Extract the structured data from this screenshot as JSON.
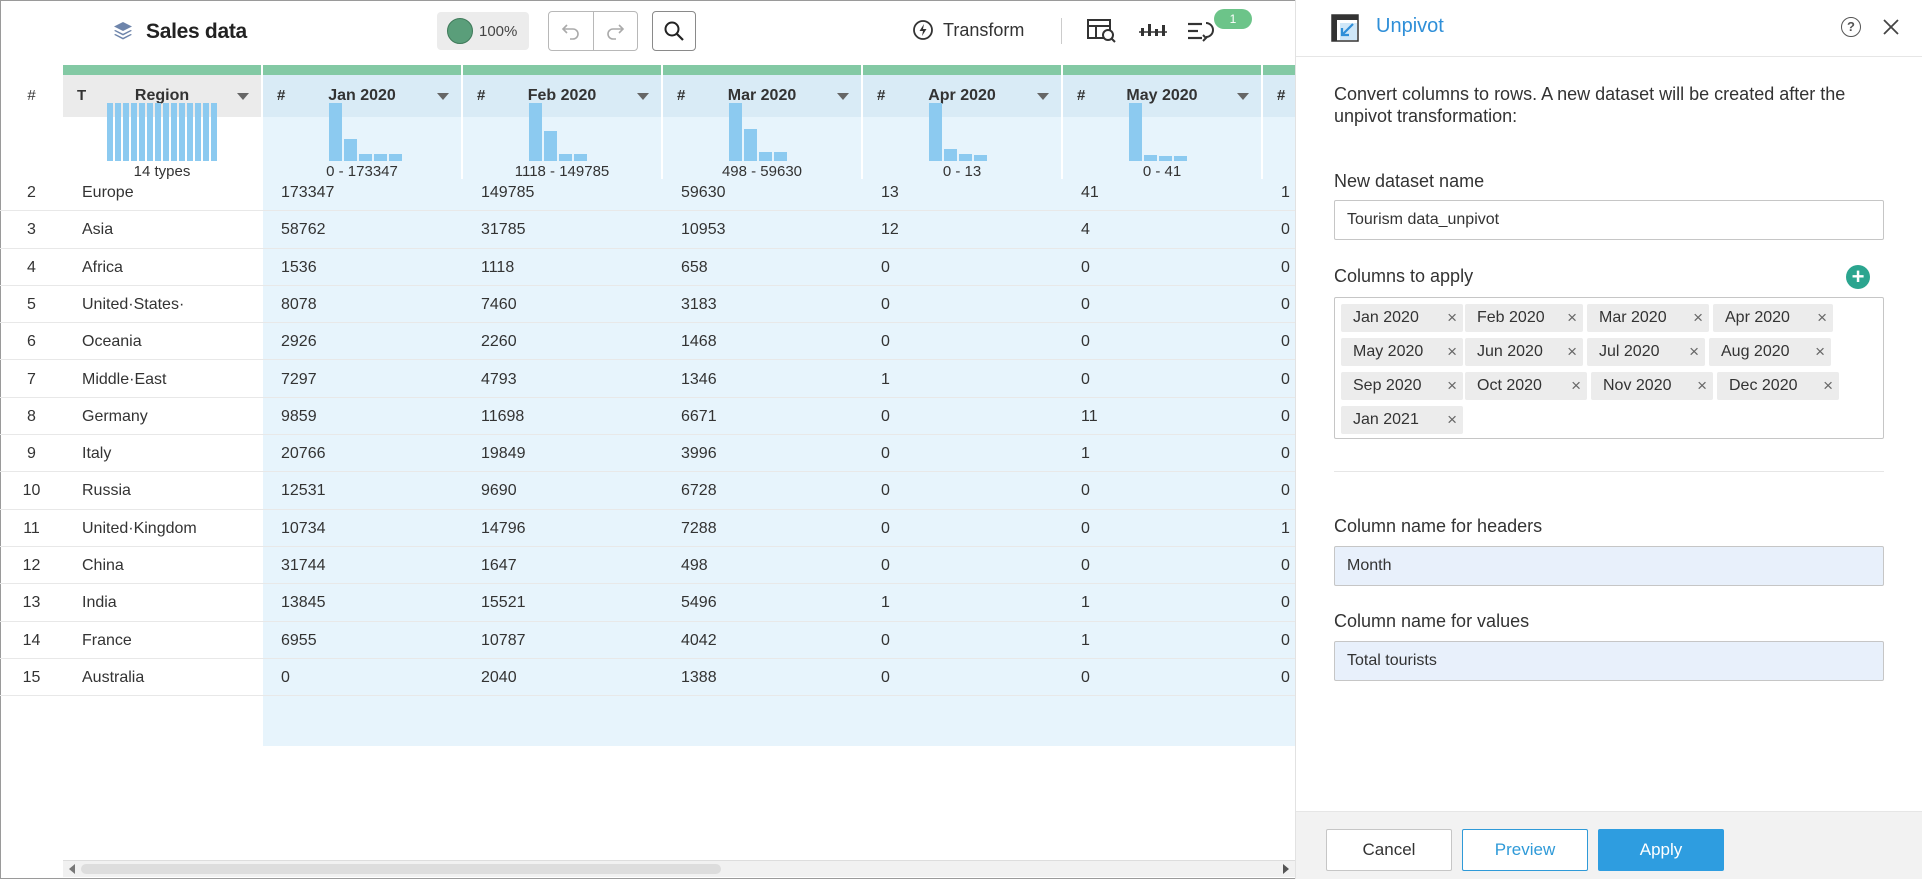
{
  "toolbar": {
    "dataset_title": "Sales data",
    "zoom": "100%",
    "transform_label": "Transform",
    "history_badge": "1",
    "colors": {
      "zoom_dot": "#5a9e7a",
      "badge": "#6cc489"
    }
  },
  "grid": {
    "index_header": "#",
    "columns": [
      {
        "type": "T",
        "label": "Region",
        "range": "14 types",
        "hist": [
          1,
          1,
          1,
          1,
          1,
          1,
          1,
          1,
          1,
          1,
          1,
          1,
          1,
          1
        ],
        "bar_color": "#8ccaf0"
      },
      {
        "type": "#",
        "label": "Jan 2020",
        "range": "0 - 173347",
        "hist": [
          1,
          0.38,
          0.12,
          0.12,
          0.12
        ]
      },
      {
        "type": "#",
        "label": "Feb 2020",
        "range": "1118 - 149785",
        "hist": [
          1,
          0.52,
          0.12,
          0.12
        ]
      },
      {
        "type": "#",
        "label": "Mar 2020",
        "range": "498 - 59630",
        "hist": [
          1,
          0.55,
          0.15,
          0.15
        ]
      },
      {
        "type": "#",
        "label": "Apr 2020",
        "range": "0 - 13",
        "hist": [
          1,
          0.2,
          0.12,
          0.1
        ]
      },
      {
        "type": "#",
        "label": "May 2020",
        "range": "0 - 41",
        "hist": [
          1,
          0.1,
          0.08,
          0.08
        ]
      },
      {
        "type": "#",
        "label": "",
        "range": "",
        "hist": []
      }
    ],
    "rows": [
      {
        "idx": "2",
        "region": "Europe",
        "v": [
          "173347",
          "149785",
          "59630",
          "13",
          "41",
          "1"
        ]
      },
      {
        "idx": "3",
        "region": "Asia",
        "v": [
          "58762",
          "31785",
          "10953",
          "12",
          "4",
          "0"
        ]
      },
      {
        "idx": "4",
        "region": "Africa",
        "v": [
          "1536",
          "1118",
          "658",
          "0",
          "0",
          "0"
        ]
      },
      {
        "idx": "5",
        "region": "United·States·",
        "v": [
          "8078",
          "7460",
          "3183",
          "0",
          "0",
          "0"
        ]
      },
      {
        "idx": "6",
        "region": "Oceania",
        "v": [
          "2926",
          "2260",
          "1468",
          "0",
          "0",
          "0"
        ]
      },
      {
        "idx": "7",
        "region": "Middle·East",
        "v": [
          "7297",
          "4793",
          "1346",
          "1",
          "0",
          "0"
        ]
      },
      {
        "idx": "8",
        "region": "Germany",
        "v": [
          "9859",
          "11698",
          "6671",
          "0",
          "11",
          "0"
        ]
      },
      {
        "idx": "9",
        "region": "Italy",
        "v": [
          "20766",
          "19849",
          "3996",
          "0",
          "1",
          "0"
        ]
      },
      {
        "idx": "10",
        "region": "Russia",
        "v": [
          "12531",
          "9690",
          "6728",
          "0",
          "0",
          "0"
        ]
      },
      {
        "idx": "11",
        "region": "United·Kingdom",
        "v": [
          "10734",
          "14796",
          "7288",
          "0",
          "0",
          "1"
        ]
      },
      {
        "idx": "12",
        "region": "China",
        "v": [
          "31744",
          "1647",
          "498",
          "0",
          "0",
          "0"
        ]
      },
      {
        "idx": "13",
        "region": "India",
        "v": [
          "13845",
          "15521",
          "5496",
          "1",
          "1",
          "0"
        ]
      },
      {
        "idx": "14",
        "region": "France",
        "v": [
          "6955",
          "10787",
          "4042",
          "0",
          "1",
          "0"
        ]
      },
      {
        "idx": "15",
        "region": "Australia",
        "v": [
          "0",
          "2040",
          "1388",
          "0",
          "0",
          "0"
        ]
      }
    ]
  },
  "panel": {
    "title": "Unpivot",
    "description": "Convert columns to rows. A new dataset will be created after the unpivot transformation:",
    "dataset_name_label": "New dataset name",
    "dataset_name_value": "Tourism data_unpivot",
    "columns_label": "Columns to apply",
    "columns": [
      "Jan 2020",
      "Feb 2020",
      "Mar 2020",
      "Apr 2020",
      "May 2020",
      "Jun 2020",
      "Jul 2020",
      "Aug 2020",
      "Sep 2020",
      "Oct 2020",
      "Nov 2020",
      "Dec 2020",
      "Jan 2021"
    ],
    "headers_label": "Column name for headers",
    "headers_value": "Month",
    "values_label": "Column name for values",
    "values_value": "Total tourists",
    "cancel_label": "Cancel",
    "preview_label": "Preview",
    "apply_label": "Apply",
    "colors": {
      "title": "#2f8fd8",
      "apply_bg": "#2e9de0",
      "add": "#2ba58f"
    }
  }
}
